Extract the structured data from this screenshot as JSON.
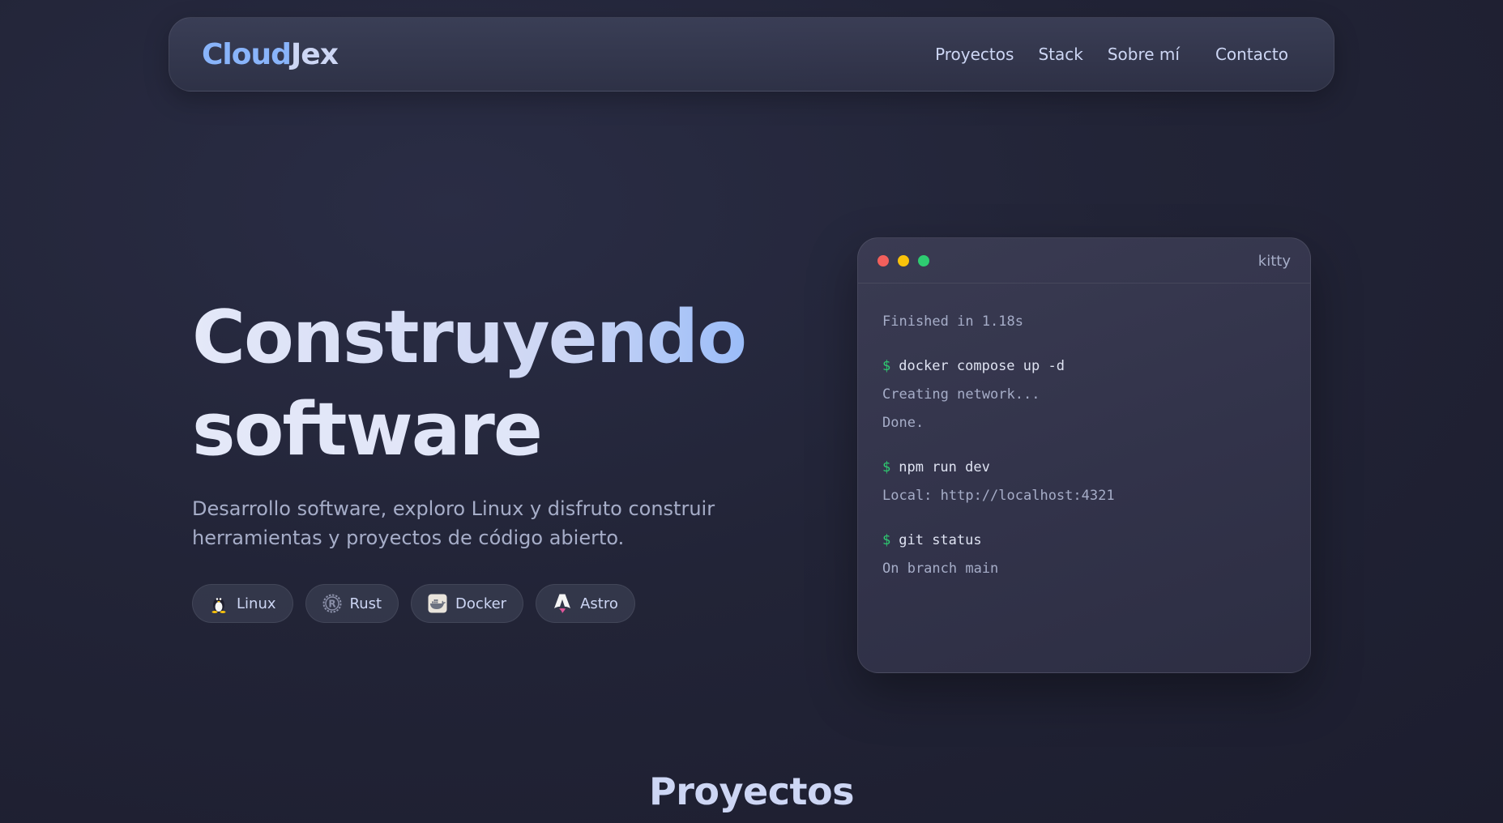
{
  "nav": {
    "logo_part1": "Cloud",
    "logo_part2": "Jex",
    "items": [
      {
        "label": "Proyectos"
      },
      {
        "label": "Stack"
      },
      {
        "label": "Sobre mí"
      },
      {
        "label": "Contacto"
      }
    ]
  },
  "hero": {
    "title_line1": "Construyendo",
    "title_line2": "software",
    "subtitle": "Desarrollo software, exploro Linux y disfruto construir herramientas y proyectos de código abierto.",
    "chips": [
      {
        "label": "Linux",
        "icon": "linux-tux-icon"
      },
      {
        "label": "Rust",
        "icon": "rust-icon"
      },
      {
        "label": "Docker",
        "icon": "docker-icon"
      },
      {
        "label": "Astro",
        "icon": "astro-icon"
      }
    ]
  },
  "terminal": {
    "title": "kitty",
    "prompt_symbol": "$",
    "lines": [
      {
        "type": "out",
        "text": "Finished in 1.18s"
      },
      {
        "type": "cmd",
        "text": "docker compose up -d"
      },
      {
        "type": "out",
        "text": "Creating network..."
      },
      {
        "type": "out",
        "text": "Done."
      },
      {
        "type": "cmd",
        "text": "npm run dev"
      },
      {
        "type": "out",
        "text": "Local: http://localhost:4321"
      },
      {
        "type": "cmd",
        "text": "git status"
      },
      {
        "type": "out",
        "text": "On branch main"
      }
    ]
  },
  "section": {
    "title": "Proyectos"
  },
  "colors": {
    "accent": "#89b4fa",
    "text": "#cdd6f4",
    "muted": "#a6adc8",
    "prompt": "#2ecc71",
    "dot_red": "#f25f5c",
    "dot_yellow": "#f9c20a",
    "dot_green": "#2ecc71"
  }
}
